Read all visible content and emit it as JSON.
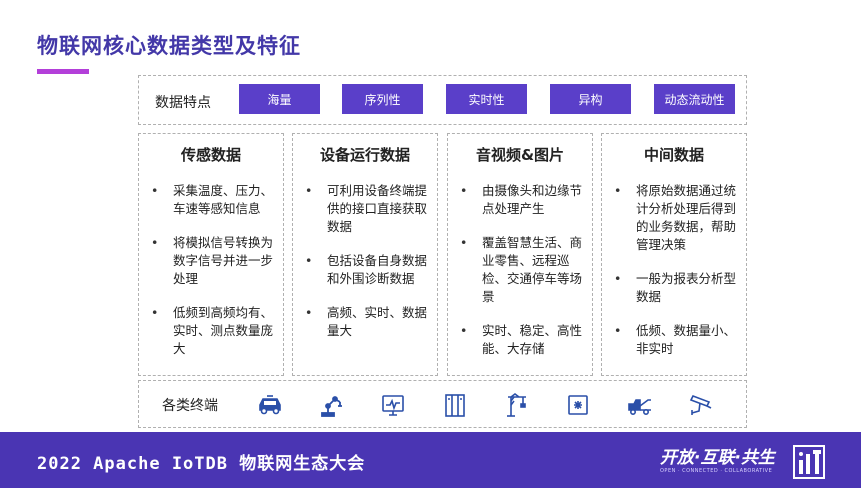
{
  "slide": {
    "title": "物联网核心数据类型及特征",
    "accent_color": "#b33fd9",
    "brand_color": "#4a35b3"
  },
  "features": {
    "label": "数据特点",
    "tags": [
      "海量",
      "序列性",
      "实时性",
      "异构",
      "动态流动性"
    ]
  },
  "cards": [
    {
      "title": "传感数据",
      "bullets": [
        "采集温度、压力、车速等感知信息",
        "将模拟信号转换为数字信号并进一步处理",
        "低频到高频均有、实时、测点数量庞大"
      ]
    },
    {
      "title": "设备运行数据",
      "bullets": [
        "可利用设备终端提供的接口直接获取数据",
        "包括设备自身数据和外围诊断数据",
        "高频、实时、数据量大"
      ]
    },
    {
      "title": "音视频&图片",
      "bullets": [
        "由摄像头和边缘节点处理产生",
        "覆盖智慧生活、商业零售、远程巡检、交通停车等场景",
        "实时、稳定、高性能、大存储"
      ]
    },
    {
      "title": "中间数据",
      "bullets": [
        "将原始数据通过统计分析处理后得到的业务数据，帮助管理决策",
        "一般为报表分析型数据",
        "低频、数据量小、非实时"
      ]
    }
  ],
  "terminals": {
    "label": "各类终端",
    "icons": [
      "car-icon",
      "robot-arm-icon",
      "monitor-icon",
      "cabinet-icon",
      "crane-icon",
      "fan-box-icon",
      "tow-truck-icon",
      "camera-icon"
    ]
  },
  "footer": {
    "event": "2022 Apache IoTDB 物联网生态大会",
    "slogan": "开放·互联·共生",
    "slogan_sub": "OPEN · CONNECTED · COLLABORATIVE"
  }
}
